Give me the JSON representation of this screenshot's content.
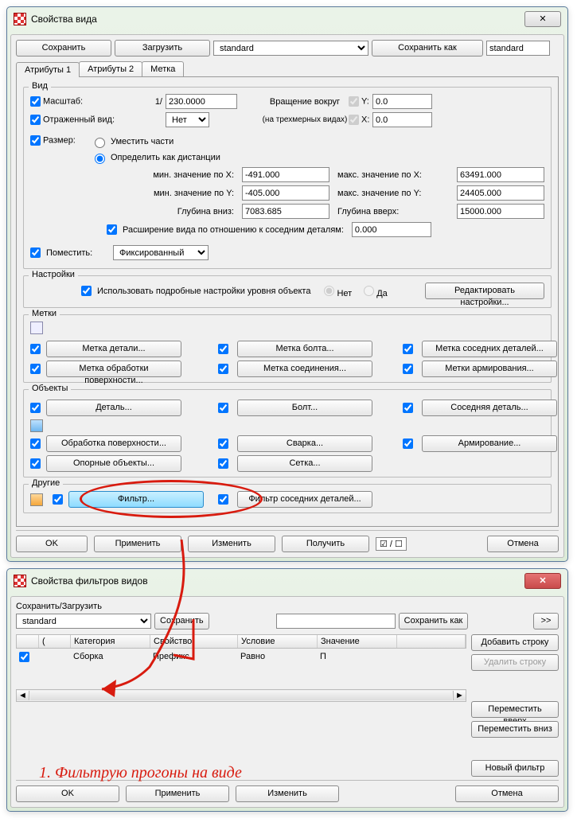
{
  "win1": {
    "title": "Свойства вида",
    "toolbar": {
      "save": "Сохранить",
      "load": "Загрузить",
      "preset": "standard",
      "save_as": "Сохранить как",
      "save_as_name": "standard"
    },
    "tabs": {
      "t1": "Атрибуты 1",
      "t2": "Атрибуты 2",
      "t3": "Метка"
    },
    "view": {
      "legend": "Вид",
      "scale_lbl": "Масштаб:",
      "scale_prefix": "1/",
      "scale_val": "230.0000",
      "reflected_lbl": "Отраженный вид:",
      "reflected_val": "Нет",
      "rotation_lbl1": "Вращение вокруг",
      "rotation_lbl2": "(на трехмерных видах)",
      "y_lbl": "Y:",
      "y_val": "0.0",
      "x_lbl": "X:",
      "x_val": "0.0",
      "size_lbl": "Размер:",
      "size_opt1": "Уместить части",
      "size_opt2": "Определить как дистанции",
      "minx_lbl": "мин. значение по X:",
      "minx_val": "-491.000",
      "maxx_lbl": "макс. значение по X:",
      "maxx_val": "63491.000",
      "miny_lbl": "мин. значение по Y:",
      "miny_val": "-405.000",
      "maxy_lbl": "макс. значение по Y:",
      "maxy_val": "24405.000",
      "depth_down_lbl": "Глубина вниз:",
      "depth_down_val": "7083.685",
      "depth_up_lbl": "Глубина вверх:",
      "depth_up_val": "15000.000",
      "extend_lbl": "Расширение вида по отношению к соседним деталям:",
      "extend_val": "0.000",
      "place_lbl": "Поместить:",
      "place_val": "Фиксированный"
    },
    "settings": {
      "legend": "Настройки",
      "use_lbl": "Использовать подробные настройки уровня объекта",
      "opt_no": "Нет",
      "opt_yes": "Да",
      "edit": "Редактировать настройки..."
    },
    "marks": {
      "legend": "Метки",
      "b1": "Метка детали...",
      "b2": "Метка болта...",
      "b3": "Метка соседних деталей...",
      "b4": "Метка обработки поверхности...",
      "b5": "Метка соединения...",
      "b6": "Метки армирования..."
    },
    "objects": {
      "legend": "Объекты",
      "b1": "Деталь...",
      "b2": "Болт...",
      "b3": "Соседняя деталь...",
      "b4": "Обработка поверхности...",
      "b5": "Сварка...",
      "b6": "Армирование...",
      "b7": "Опорные объекты...",
      "b8": "Сетка..."
    },
    "other": {
      "legend": "Другие",
      "b1": "Фильтр...",
      "b2": "Фильтр соседних деталей..."
    },
    "footer": {
      "ok": "OK",
      "apply": "Применить",
      "change": "Изменить",
      "get": "Получить",
      "cancel": "Отмена"
    }
  },
  "win2": {
    "title": "Свойства фильтров видов",
    "saveload_lbl": "Сохранить/Загрузить",
    "preset": "standard",
    "save": "Сохранить",
    "save_as": "Сохранить как",
    "expand": ">>",
    "cols": {
      "chk": "",
      "paren": "(",
      "cat": "Категория",
      "prop": "Свойство",
      "cond": "Условие",
      "val": "Значение"
    },
    "row": {
      "cat": "Сборка",
      "prop": "Префикс",
      "cond": "Равно",
      "val": "П"
    },
    "side": {
      "add": "Добавить строку",
      "del": "Удалить строку",
      "up": "Переместить вверх",
      "down": "Переместить вниз",
      "new": "Новый фильтр"
    },
    "footer": {
      "ok": "OK",
      "apply": "Применить",
      "change": "Изменить",
      "cancel": "Отмена"
    }
  },
  "annotation": "1. Фильтрую прогоны на виде"
}
